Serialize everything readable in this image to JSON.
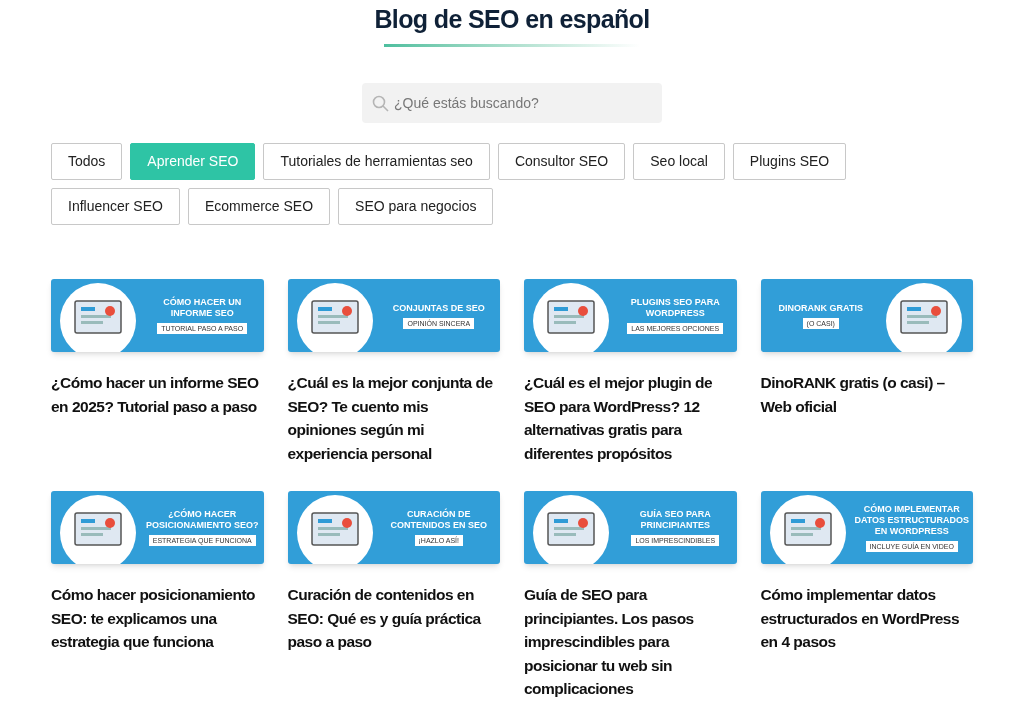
{
  "heading": "Blog de SEO en español",
  "search": {
    "placeholder": "¿Qué estás buscando?"
  },
  "filters": [
    {
      "label": "Todos",
      "selected": false
    },
    {
      "label": "Aprender SEO",
      "selected": true
    },
    {
      "label": "Tutoriales de herramientas seo",
      "selected": false
    },
    {
      "label": "Consultor SEO",
      "selected": false
    },
    {
      "label": "Seo local",
      "selected": false
    },
    {
      "label": "Plugins SEO",
      "selected": false
    },
    {
      "label": "Influencer SEO",
      "selected": false
    },
    {
      "label": "Ecommerce SEO",
      "selected": false
    },
    {
      "label": "SEO para negocios",
      "selected": false
    }
  ],
  "posts": [
    {
      "banner": {
        "title": "CÓMO HACER UN INFORME SEO",
        "tag": "TUTORIAL PASO A PASO",
        "kind": "left"
      },
      "title": "¿Cómo hacer un informe SEO en 2025? Tutorial paso a paso"
    },
    {
      "banner": {
        "title": "CONJUNTAS DE SEO",
        "tag": "OPINIÓN SINCERA",
        "kind": "left"
      },
      "title": "¿Cuál es la mejor conjunta de SEO? Te cuento mis opiniones según mi experiencia personal"
    },
    {
      "banner": {
        "title": "PLUGINS SEO PARA WORDPRESS",
        "tag": "LAS MEJORES OPCIONES",
        "kind": "left"
      },
      "title": "¿Cuál es el mejor plugin de SEO para WordPress? 12 alternativas gratis para diferentes propósitos"
    },
    {
      "banner": {
        "title": "DINORANK GRATIS",
        "tag": "(O CASI)",
        "kind": "right"
      },
      "title": "DinoRANK gratis (o casi) – Web oficial"
    },
    {
      "banner": {
        "title": "¿CÓMO HACER POSICIONAMIENTO SEO?",
        "tag": "ESTRATEGIA QUE FUNCIONA",
        "kind": "left"
      },
      "title": "Cómo hacer posicionamiento SEO: te explicamos una estrategia que funciona"
    },
    {
      "banner": {
        "title": "CURACIÓN DE CONTENIDOS EN SEO",
        "tag": "¡HAZLO ASÍ!",
        "kind": "left"
      },
      "title": "Curación de contenidos en SEO: Qué es y guía práctica paso a paso"
    },
    {
      "banner": {
        "title": "GUÍA SEO PARA PRINCIPIANTES",
        "tag": "LOS IMPRESCINDIBLES",
        "kind": "left"
      },
      "title": "Guía de SEO para principiantes. Los pasos imprescindibles para posicionar tu web sin complicaciones"
    },
    {
      "banner": {
        "title": "CÓMO IMPLEMENTAR DATOS ESTRUCTURADOS EN WORDPRESS",
        "tag": "INCLUYE GUÍA EN VIDEO",
        "kind": "left"
      },
      "title": "Cómo implementar datos estructurados en WordPress en 4 pasos"
    }
  ]
}
